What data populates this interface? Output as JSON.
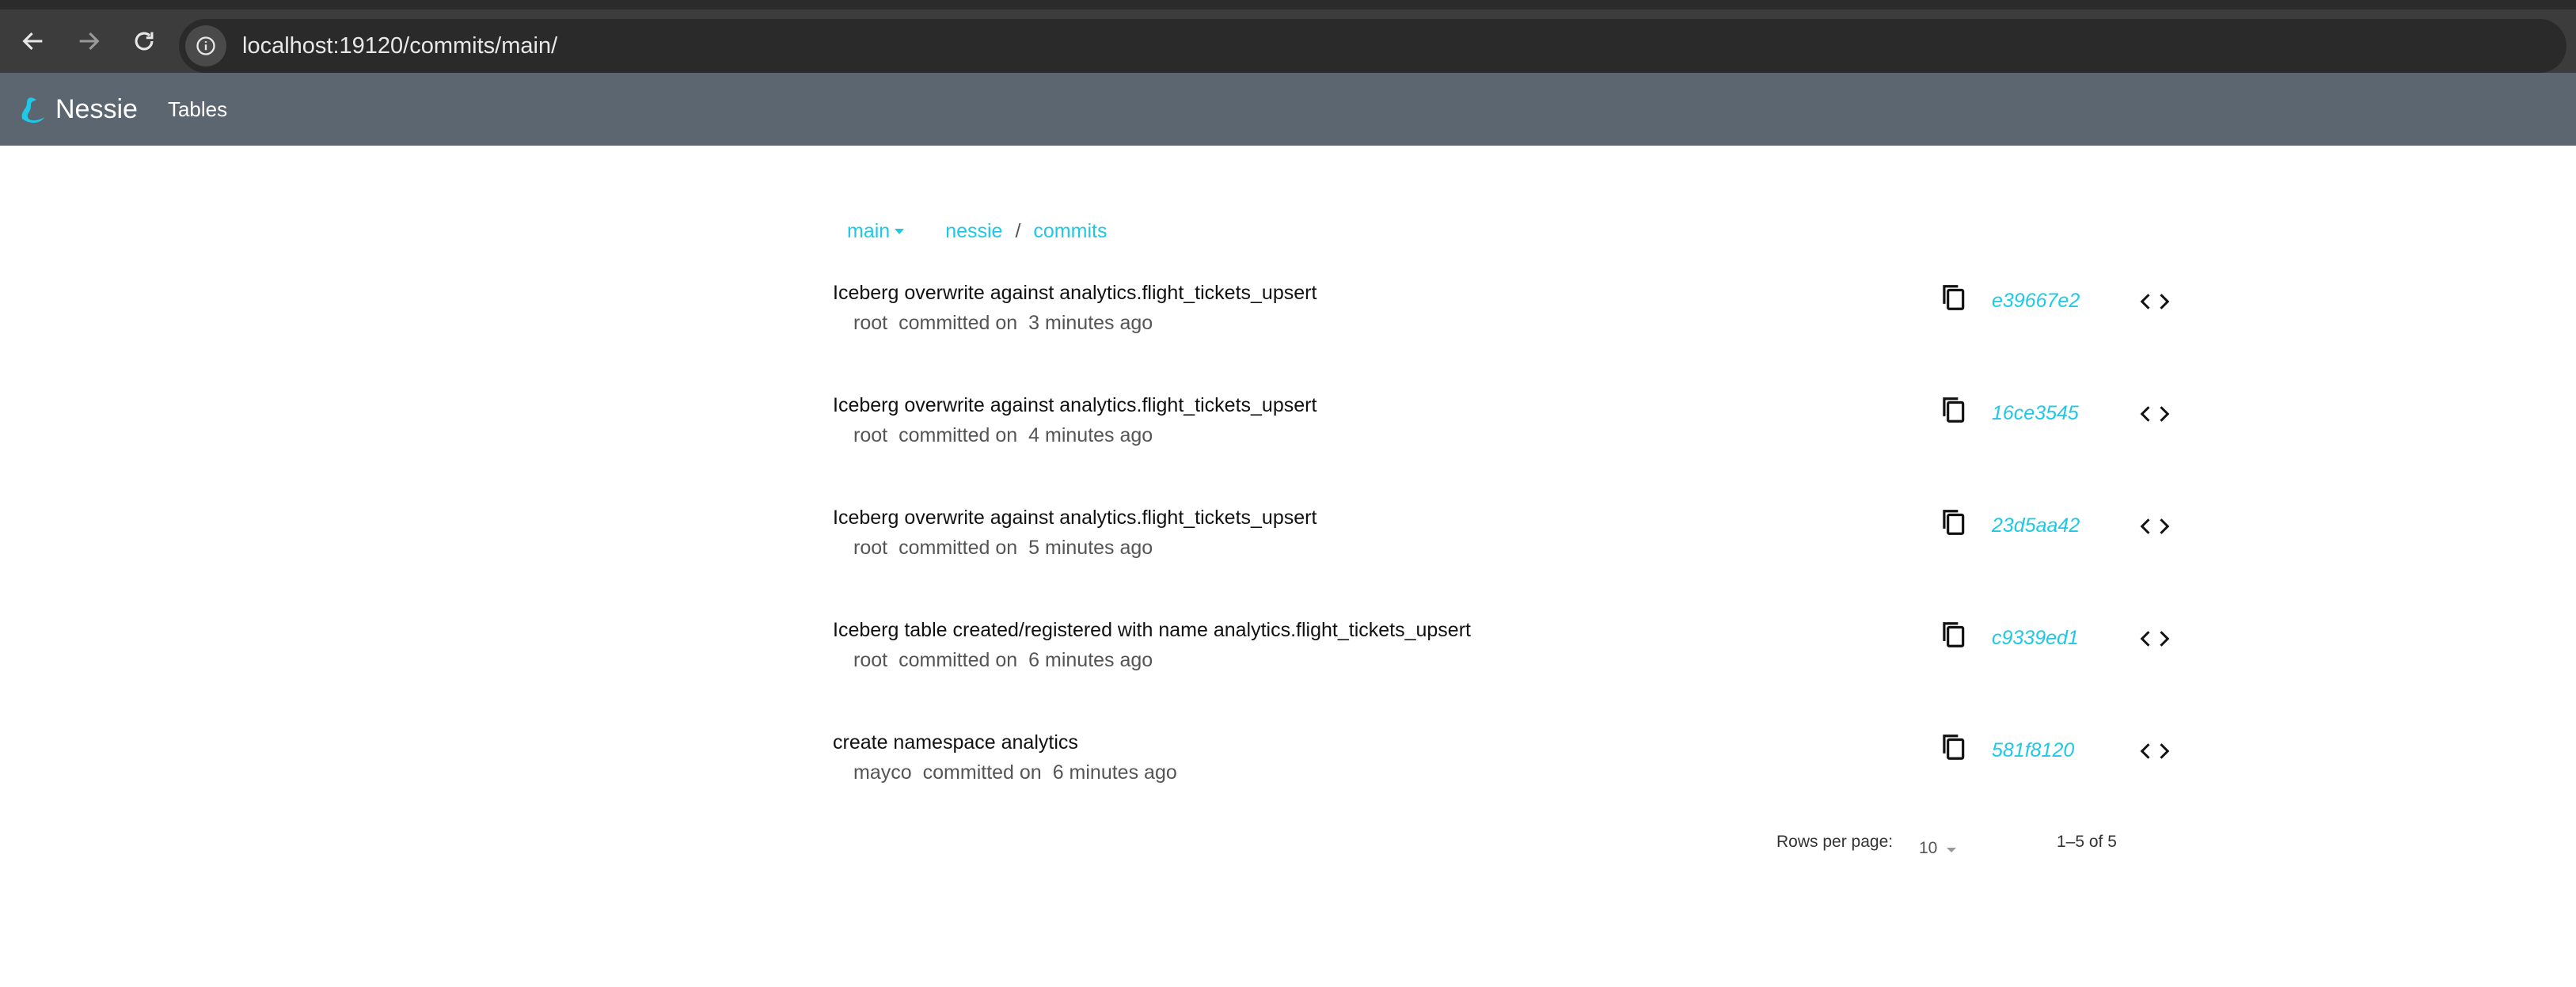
{
  "browser": {
    "url": "localhost:19120/commits/main/"
  },
  "header": {
    "brand": "Nessie",
    "nav_tables": "Tables"
  },
  "breadcrumb": {
    "branch": "main",
    "items": [
      "nessie",
      "commits"
    ],
    "separator": "/"
  },
  "commits": [
    {
      "message": "Iceberg overwrite against analytics.flight_tickets_upsert",
      "author": "root",
      "committed_on": "committed on",
      "time": "3 minutes ago",
      "hash": "e39667e2"
    },
    {
      "message": "Iceberg overwrite against analytics.flight_tickets_upsert",
      "author": "root",
      "committed_on": "committed on",
      "time": "4 minutes ago",
      "hash": "16ce3545"
    },
    {
      "message": "Iceberg overwrite against analytics.flight_tickets_upsert",
      "author": "root",
      "committed_on": "committed on",
      "time": "5 minutes ago",
      "hash": "23d5aa42"
    },
    {
      "message": "Iceberg table created/registered with name analytics.flight_tickets_upsert",
      "author": "root",
      "committed_on": "committed on",
      "time": "6 minutes ago",
      "hash": "c9339ed1"
    },
    {
      "message": "create namespace analytics",
      "author": "mayco",
      "committed_on": "committed on",
      "time": "6 minutes ago",
      "hash": "581f8120"
    }
  ],
  "pagination": {
    "rows_label": "Rows per page:",
    "rows_value": "10",
    "range": "1–5 of 5"
  },
  "colors": {
    "accent": "#1ec8e6",
    "header_bg": "#5b6670",
    "chrome_bg": "#3c3c3c"
  },
  "icons": {
    "back": "arrow-left-icon",
    "forward": "arrow-right-icon",
    "reload": "reload-icon",
    "site_info": "info-icon",
    "logo": "nessie-logo-icon",
    "copy": "copy-icon",
    "code": "code-icon"
  }
}
